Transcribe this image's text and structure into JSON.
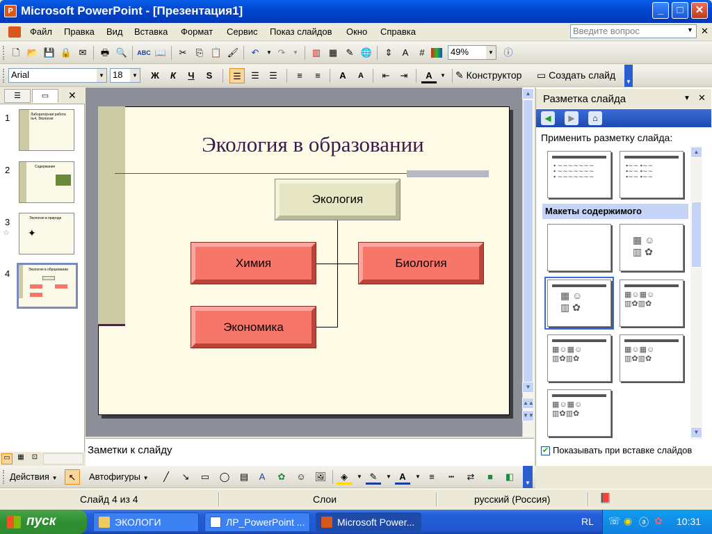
{
  "window": {
    "title": "Microsoft PowerPoint - [Презентация1]",
    "minimize": "_",
    "maximize": "□",
    "close": "✕"
  },
  "menu": {
    "items": [
      "Файл",
      "Правка",
      "Вид",
      "Вставка",
      "Формат",
      "Сервис",
      "Показ слайдов",
      "Окно",
      "Справка"
    ],
    "ask_placeholder": "Введите вопрос"
  },
  "toolbar": {
    "zoom": "49%"
  },
  "format": {
    "font": "Arial",
    "size": "18",
    "bold": "Ж",
    "italic": "К",
    "underline": "Ч",
    "shadow": "S",
    "designer": "Конструктор",
    "new_slide": "Создать слайд"
  },
  "thumbnails": [
    {
      "num": "1",
      "caption": "Лабораторная работа №4. Экология"
    },
    {
      "num": "2",
      "caption": "Содержание"
    },
    {
      "num": "3",
      "caption": "Экология в природе"
    },
    {
      "num": "4",
      "caption": "Экология в образовании"
    }
  ],
  "slide": {
    "title": "Экология в образовании",
    "boxes": {
      "top": "Экология",
      "left": "Химия",
      "right": "Биология",
      "bottom": "Экономика"
    }
  },
  "notes": {
    "text": "Заметки к слайду"
  },
  "taskpane": {
    "title": "Разметка слайда",
    "apply_label": "Применить разметку слайда:",
    "group_label": "Макеты содержимого",
    "show_on_insert": "Показывать при вставке слайдов"
  },
  "draw": {
    "actions": "Действия",
    "autoshapes": "Автофигуры"
  },
  "status": {
    "slide": "Слайд 4 из 4",
    "design": "Слои",
    "language": "русский (Россия)"
  },
  "taskbar": {
    "start": "пуск",
    "tasks": [
      "ЭКОЛОГИ",
      "ЛР_PowerPoint ...",
      "Microsoft Power..."
    ],
    "lang": "RL",
    "time": "10:31"
  },
  "colors": {
    "accent_red": "#f7766a",
    "accent_beige": "#e7e6c4",
    "title_color": "#3a1a4e"
  }
}
